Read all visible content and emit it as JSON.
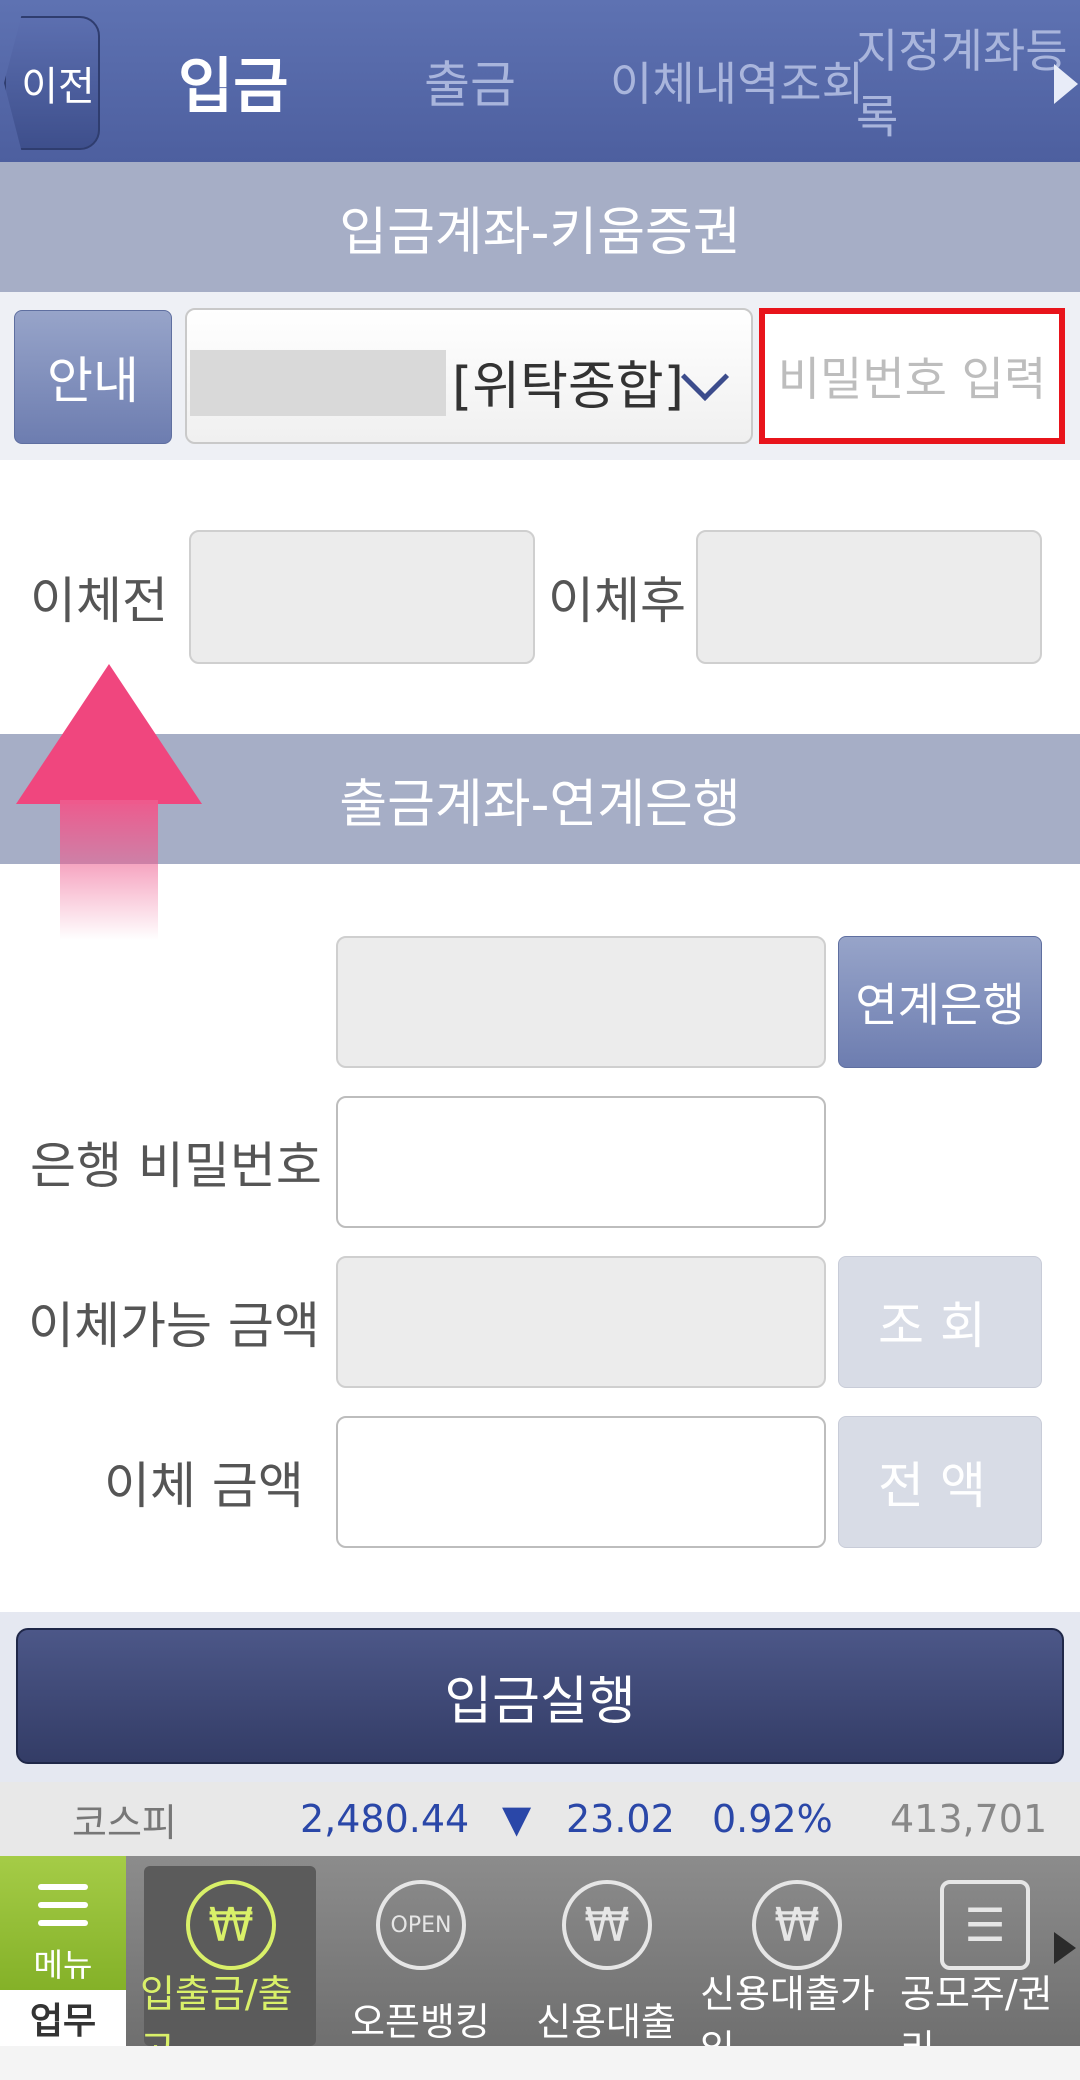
{
  "topbar": {
    "back_label": "이전",
    "tabs": [
      {
        "label": "입금",
        "active": true
      },
      {
        "label": "출금",
        "active": false
      },
      {
        "label": "이체내역조회",
        "active": false
      },
      {
        "label": "지정계좌등록",
        "active": false
      }
    ]
  },
  "deposit_section": {
    "title": "입금계좌-키움증권",
    "guide_button": "안내",
    "account_type": "[위탁종합]",
    "password_placeholder": "비밀번호 입력",
    "before_label": "이체전",
    "after_label": "이체후"
  },
  "withdraw_section": {
    "title": "출금계좌-연계은행",
    "linked_bank_button": "연계은행",
    "bank_password_label": "은행 비밀번호",
    "available_amount_label": "이체가능 금액",
    "inquiry_button": "조회",
    "transfer_amount_label": "이체 금액",
    "full_amount_button": "전액"
  },
  "execute_button": "입금실행",
  "ticker": {
    "index_name": "코스피",
    "value": "2,480.44",
    "direction": "▼",
    "change": "23.02",
    "percent": "0.92%",
    "volume": "413,701"
  },
  "bottom_nav": {
    "menu_label": "메뉴",
    "work_label": "업무",
    "items": [
      {
        "label": "입출금/출고",
        "icon": "mouse-money-icon",
        "active": true
      },
      {
        "label": "오픈뱅킹",
        "icon": "open-refresh-icon",
        "active": false
      },
      {
        "label": "신용대출",
        "icon": "won-coin-icon",
        "active": false
      },
      {
        "label": "신용대출가입",
        "icon": "won-coin-icon",
        "active": false
      },
      {
        "label": "공모주/권리",
        "icon": "document-list-icon",
        "active": false
      }
    ]
  },
  "colors": {
    "header": "#5e72b2",
    "section": "#a6aec6",
    "highlight_border": "#e8141b",
    "ticker_value": "#2a47a8",
    "menu_green": "#8fba32",
    "arrow_pink": "#f0467e"
  }
}
